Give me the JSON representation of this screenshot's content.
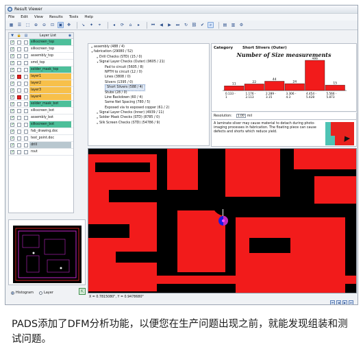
{
  "window": {
    "title": "Result Viewer"
  },
  "menu": [
    "File",
    "Edit",
    "View",
    "Results",
    "Tools",
    "Help"
  ],
  "layer_list": {
    "header": "Layer List",
    "rows": [
      {
        "name": "silkscreen_top",
        "color": "#4dbf9a",
        "visible": true,
        "highlight": false
      },
      {
        "name": "silkscreen_top",
        "color": "#ffffff",
        "visible": true,
        "highlight": false
      },
      {
        "name": "assembly_top",
        "color": "#ffffff",
        "visible": true,
        "highlight": false
      },
      {
        "name": "smd_top",
        "color": "#ffffff",
        "visible": true,
        "highlight": false
      },
      {
        "name": "solder_mask_top",
        "color": "#4dbf9a",
        "visible": true,
        "highlight": false
      },
      {
        "name": "layer1",
        "color": "#f7c04a",
        "visible": true,
        "highlight": true
      },
      {
        "name": "layer2",
        "color": "#f7c04a",
        "visible": true,
        "highlight": false
      },
      {
        "name": "layer3",
        "color": "#f7c04a",
        "visible": true,
        "highlight": false
      },
      {
        "name": "layer4",
        "color": "#f7c04a",
        "visible": true,
        "highlight": true
      },
      {
        "name": "solder_mask_bot",
        "color": "#4dbf9a",
        "visible": true,
        "highlight": false
      },
      {
        "name": "silkscreen_bot",
        "color": "#ffffff",
        "visible": true,
        "highlight": false
      },
      {
        "name": "assembly_bot",
        "color": "#ffffff",
        "visible": true,
        "highlight": false
      },
      {
        "name": "silkscreen_bot",
        "color": "#4dbf9a",
        "visible": true,
        "highlight": false
      },
      {
        "name": "fab_drawing.doc",
        "color": "#ffffff",
        "visible": true,
        "highlight": false
      },
      {
        "name": "test_point.doc",
        "color": "#ffffff",
        "visible": true,
        "highlight": false
      },
      {
        "name": "drill",
        "color": "#b8c7cf",
        "visible": true,
        "highlight": false
      },
      {
        "name": "rout",
        "color": "#ffffff",
        "visible": true,
        "highlight": false
      }
    ]
  },
  "view_options": {
    "histogram": "Histogram",
    "layer": "Layer"
  },
  "tree": [
    {
      "label": "assembly (488 / 4)",
      "level": 0,
      "toggle": "▸"
    },
    {
      "label": "fabrication (29080 / 52)",
      "level": 0,
      "toggle": "▾"
    },
    {
      "label": "Drill Checks (STD) (15 / 0)",
      "level": 1,
      "toggle": "▸"
    },
    {
      "label": "Signal Layer Checks (Outer) (9605 / 21)",
      "level": 1,
      "toggle": "▾"
    },
    {
      "label": "Pad to circuit (5605 / 8)",
      "level": 2,
      "toggle": ""
    },
    {
      "label": "NPTH to circuit (12 / 0)",
      "level": 2,
      "toggle": ""
    },
    {
      "label": "Lines (3808 / 0)",
      "level": 2,
      "toggle": ""
    },
    {
      "label": "Slivers (1395 / 0)",
      "level": 2,
      "toggle": ""
    },
    {
      "label": "Short Slivers (588 / 4)",
      "level": 2,
      "toggle": "",
      "selected": true
    },
    {
      "label": "Stubs (28 / 0)",
      "level": 2,
      "toggle": ""
    },
    {
      "label": "Line Backdown (60 / 4)",
      "level": 2,
      "toggle": ""
    },
    {
      "label": "Same Net Spacing (780 / 5)",
      "level": 2,
      "toggle": ""
    },
    {
      "label": "Exposed via to exposed copper (61 / 2)",
      "level": 2,
      "toggle": ""
    },
    {
      "label": "Signal Layer Checks (Inner) (4939 / 11)",
      "level": 1,
      "toggle": "▸"
    },
    {
      "label": "Solder Mask Checks (STD) (8785 / 0)",
      "level": 1,
      "toggle": "▸"
    },
    {
      "label": "Silk Screen Checks (STD) (54786 / 9)",
      "level": 1,
      "toggle": "▸"
    }
  ],
  "category": {
    "label": "Category",
    "value": "Short Slivers (Outer)"
  },
  "resolution": {
    "label": "Resolution:",
    "value": "1.00",
    "unit": "mil"
  },
  "description": "A laminate sliver may cause material to detach during photo-imaging processes in fabrication. The floating piece can cause defects and shorts which reduce yield.",
  "chart_data": {
    "type": "bar",
    "title": "Number of Size measurements",
    "categories": [
      "0.133 - 1",
      "1.176 - 2.113",
      "2.289 - 3.15",
      "3.306 - 4.3",
      "4.454 - 5.428",
      "5.566 - 5.873"
    ],
    "values": [
      11,
      22,
      44,
      24,
      466,
      15
    ],
    "bar_color": "#f21b1b"
  },
  "status": {
    "coords": "X = 0.7815080\", Y = 0.9478680\""
  },
  "caption": "PADS添加了DFM分析功能，以便您在生产问题出现之前，就能发现组装和测试问题。"
}
